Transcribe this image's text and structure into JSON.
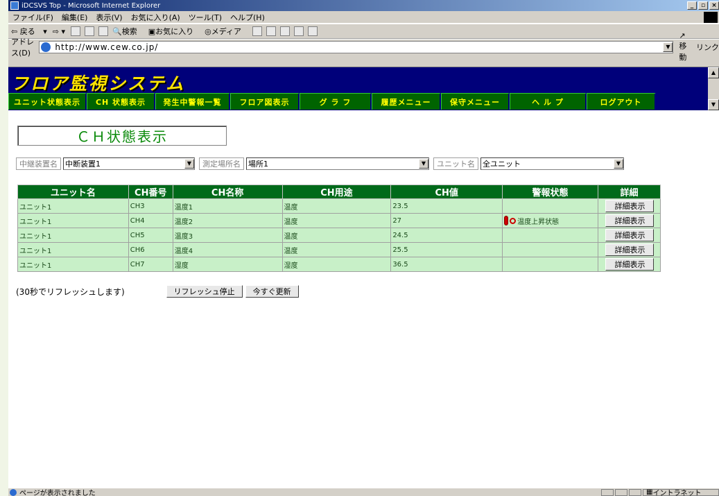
{
  "window": {
    "title": "iDCSVS Top - Microsoft Internet Explorer"
  },
  "menubar": {
    "items": [
      "ファイル(F)",
      "編集(E)",
      "表示(V)",
      "お気に入り(A)",
      "ツール(T)",
      "ヘルプ(H)"
    ]
  },
  "toolbar": {
    "back": "戻る",
    "search": "検索",
    "favorites": "お気に入り",
    "media": "メディア"
  },
  "address": {
    "label": "アドレス(D)",
    "url": "http://www.cew.co.jp/",
    "go": "移動",
    "links": "リンク"
  },
  "app": {
    "logo": "フロア監視システム",
    "nav": [
      "ユニット状態表示",
      "CH 状態表示",
      "発生中警報一覧",
      "フロア図表示",
      "グ ラ フ",
      "履歴メニュー",
      "保守メニュー",
      "ヘ ル プ",
      "ログアウト"
    ]
  },
  "page": {
    "heading": "ＣＨ状態表示",
    "filters": {
      "relay_label": "中継装置名",
      "relay_value": "中断装置1",
      "place_label": "測定場所名",
      "place_value": "場所1",
      "unit_label": "ユニット名",
      "unit_value": "全ユニット"
    },
    "table": {
      "headers": [
        "ユニット名",
        "CH番号",
        "CH名称",
        "CH用途",
        "CH値",
        "警報状態",
        "詳細"
      ],
      "rows": [
        {
          "unit": "ユニット1",
          "ch": "CH3",
          "name": "温度1",
          "use": "温度",
          "value": "23.5",
          "alarm": "",
          "detail": "詳細表示"
        },
        {
          "unit": "ユニット1",
          "ch": "CH4",
          "name": "温度2",
          "use": "温度",
          "value": "27",
          "alarm": "温度上昇状態",
          "detail": "詳細表示"
        },
        {
          "unit": "ユニット1",
          "ch": "CH5",
          "name": "温度3",
          "use": "温度",
          "value": "24.5",
          "alarm": "",
          "detail": "詳細表示"
        },
        {
          "unit": "ユニット1",
          "ch": "CH6",
          "name": "温度4",
          "use": "温度",
          "value": "25.5",
          "alarm": "",
          "detail": "詳細表示"
        },
        {
          "unit": "ユニット1",
          "ch": "CH7",
          "name": "湿度",
          "use": "湿度",
          "value": "36.5",
          "alarm": "",
          "detail": "詳細表示"
        }
      ]
    },
    "refresh_note": "(30秒でリフレッシュします)",
    "stop_button": "リフレッシュ停止",
    "update_button": "今すぐ更新"
  },
  "status": {
    "text": "ページが表示されました",
    "zone": "イントラネット"
  },
  "colors": {
    "banner": "#00007a",
    "nav_bg": "#006400",
    "nav_text": "#ffff00",
    "header_bg": "#006a1a",
    "row_bg": "#c8f0c8",
    "heading_text": "#0a8a0a"
  }
}
